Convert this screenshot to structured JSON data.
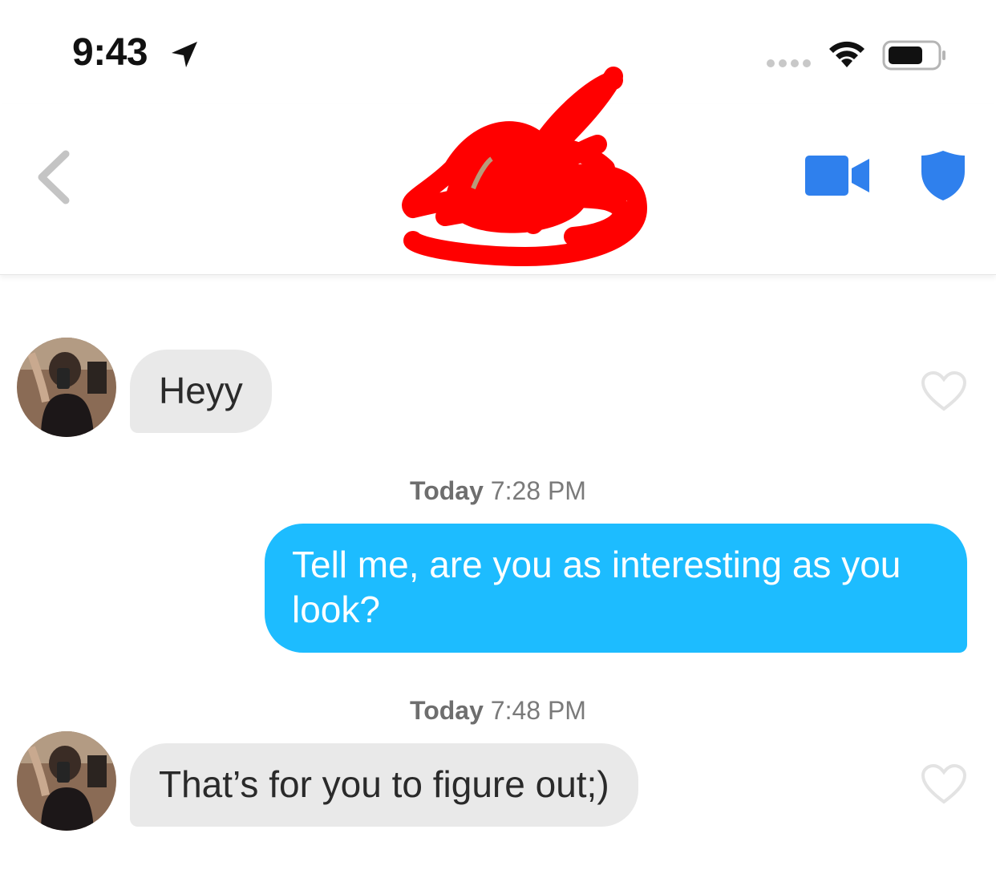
{
  "status_bar": {
    "time": "9:43",
    "location_icon": "location-arrow-icon",
    "signal_icon": "signal-dots-icon",
    "wifi_icon": "wifi-icon",
    "battery_icon": "battery-icon"
  },
  "header": {
    "back_icon": "chevron-left-icon",
    "video_icon": "video-camera-icon",
    "shield_icon": "shield-icon",
    "accent_color": "#2f80ed"
  },
  "messages": [
    {
      "direction": "incoming",
      "text": "Heyy"
    },
    {
      "direction": "timestamp",
      "day": "Today",
      "time": "7:28 PM"
    },
    {
      "direction": "outgoing",
      "text": "Tell me, are you as interesting as you look?"
    },
    {
      "direction": "timestamp",
      "day": "Today",
      "time": "7:48 PM"
    },
    {
      "direction": "incoming",
      "text": "That’s for you to figure out;)"
    }
  ],
  "colors": {
    "incoming_bubble": "#e9e9e9",
    "outgoing_bubble": "#1dbcff",
    "redaction": "#ff0000"
  }
}
